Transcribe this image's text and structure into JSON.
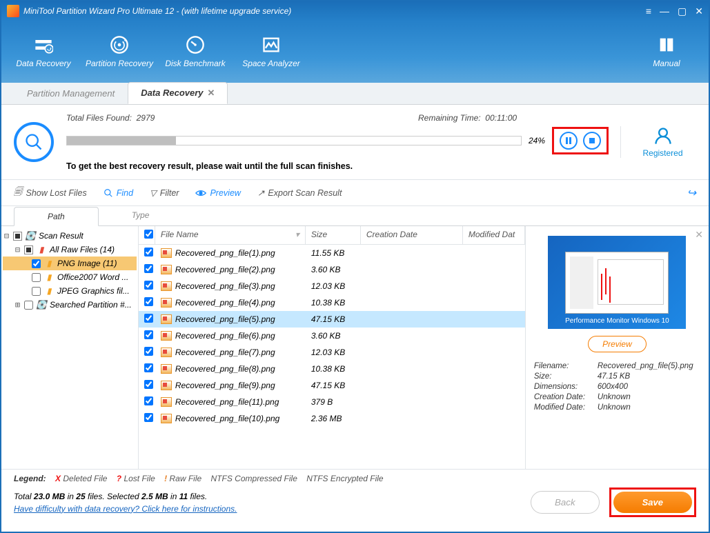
{
  "title": "MiniTool Partition Wizard Pro Ultimate 12 - (with lifetime upgrade service)",
  "ribbon": {
    "data_recovery": "Data Recovery",
    "partition_recovery": "Partition Recovery",
    "disk_benchmark": "Disk Benchmark",
    "space_analyzer": "Space Analyzer",
    "manual": "Manual"
  },
  "tabs": {
    "partition_mgmt": "Partition Management",
    "data_recovery": "Data Recovery"
  },
  "scan": {
    "found_label": "Total Files Found:",
    "found_count": "2979",
    "remaining_label": "Remaining Time:",
    "remaining_value": "00:11:00",
    "percent": "24%",
    "message": "To get the best recovery result, please wait until the full scan finishes.",
    "registered": "Registered"
  },
  "toolbar": {
    "show_lost": "Show Lost Files",
    "find": "Find",
    "filter": "Filter",
    "preview": "Preview",
    "export": "Export Scan Result"
  },
  "subtabs": {
    "path": "Path",
    "type": "Type"
  },
  "tree": {
    "scan_result": "Scan Result",
    "all_raw": "All Raw Files (14)",
    "png": "PNG Image (11)",
    "office": "Office2007 Word ...",
    "jpeg": "JPEG Graphics fil...",
    "searched": "Searched Partition #..."
  },
  "cols": {
    "name": "File Name",
    "size": "Size",
    "cdate": "Creation Date",
    "mdate": "Modified Dat"
  },
  "files": [
    {
      "name": "Recovered_png_file(1).png",
      "size": "11.55 KB"
    },
    {
      "name": "Recovered_png_file(2).png",
      "size": "3.60 KB"
    },
    {
      "name": "Recovered_png_file(3).png",
      "size": "12.03 KB"
    },
    {
      "name": "Recovered_png_file(4).png",
      "size": "10.38 KB"
    },
    {
      "name": "Recovered_png_file(5).png",
      "size": "47.15 KB",
      "selected": true
    },
    {
      "name": "Recovered_png_file(6).png",
      "size": "3.60 KB"
    },
    {
      "name": "Recovered_png_file(7).png",
      "size": "12.03 KB"
    },
    {
      "name": "Recovered_png_file(8).png",
      "size": "10.38 KB"
    },
    {
      "name": "Recovered_png_file(9).png",
      "size": "47.15 KB"
    },
    {
      "name": "Recovered_png_file(11).png",
      "size": "379 B"
    },
    {
      "name": "Recovered_png_file(10).png",
      "size": "2.36 MB"
    }
  ],
  "preview": {
    "caption": "Performance Monitor Windows 10",
    "button": "Preview",
    "filename_k": "Filename:",
    "filename_v": "Recovered_png_file(5).png",
    "size_k": "Size:",
    "size_v": "47.15 KB",
    "dim_k": "Dimensions:",
    "dim_v": "600x400",
    "cdate_k": "Creation Date:",
    "cdate_v": "Unknown",
    "mdate_k": "Modified Date:",
    "mdate_v": "Unknown"
  },
  "legend": {
    "label": "Legend:",
    "deleted": "Deleted File",
    "lost": "Lost File",
    "raw": "Raw File",
    "ntfs_c": "NTFS Compressed File",
    "ntfs_e": "NTFS Encrypted File"
  },
  "footer": {
    "stats_1": "Total ",
    "stats_total": "23.0 MB",
    "stats_2": " in ",
    "stats_totalfiles": "25",
    "stats_3": " files.  Selected ",
    "stats_sel": "2.5 MB",
    "stats_4": " in ",
    "stats_selfiles": "11",
    "stats_5": " files.",
    "help": "Have difficulty with data recovery? Click here for instructions.",
    "back": "Back",
    "save": "Save"
  }
}
